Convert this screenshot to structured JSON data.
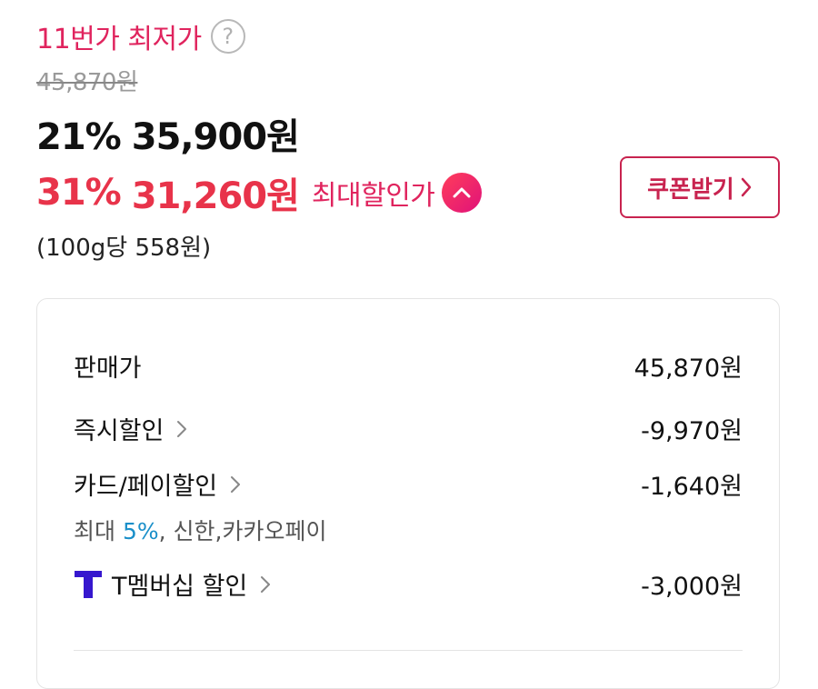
{
  "header": {
    "lowest_label": "11번가 최저가",
    "help_icon": "question-circle-icon",
    "original_price": "45,870원"
  },
  "price": {
    "discount_pct": "21%",
    "amount": "35,900원"
  },
  "max_discount": {
    "pct": "31%",
    "amount": "31,260원",
    "label": "최대할인가",
    "toggle_icon": "chevron-up-icon"
  },
  "unit_price": "(100g당 558원)",
  "coupon": {
    "label": "쿠폰받기"
  },
  "breakdown": {
    "sale_price": {
      "label": "판매가",
      "value": "45,870원"
    },
    "instant": {
      "label": "즉시할인",
      "value": "-9,970원"
    },
    "card": {
      "label": "카드/페이할인",
      "value": "-1,640원",
      "sub_prefix": "최대 ",
      "sub_highlight": "5%",
      "sub_suffix": ", 신한,카카오페이"
    },
    "tmembership": {
      "label": "T멤버십 할인",
      "value": "-3,000원",
      "icon": "t-membership-logo-icon"
    }
  },
  "colors": {
    "accent": "#e0245e",
    "price_red": "#e8334a",
    "highlight_blue": "#1a8fc9",
    "t_logo": "#3617ce"
  }
}
